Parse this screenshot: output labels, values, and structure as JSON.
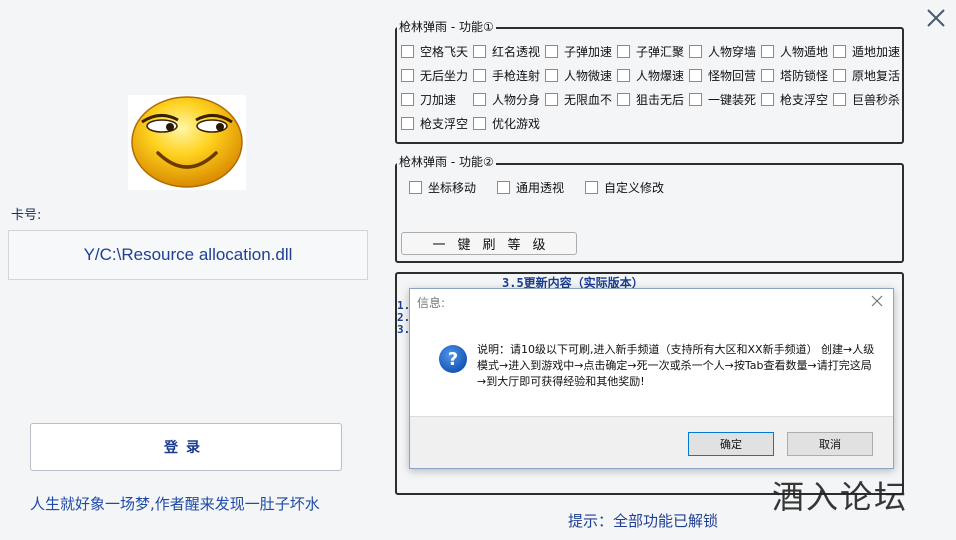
{
  "card": {
    "label": "卡号:",
    "value": "Y/C:\\Resource allocation.dll"
  },
  "login_label": "登录",
  "motto": "人生就好象一场梦,作者醒来发现一肚子坏水",
  "group1": {
    "title": "枪林弹雨 - 功能①",
    "items": [
      {
        "label": "空格飞天",
        "checked": false
      },
      {
        "label": "红名透视",
        "checked": false
      },
      {
        "label": "子弹加速",
        "checked": false
      },
      {
        "label": "子弹汇聚",
        "checked": false
      },
      {
        "label": "人物穿墙",
        "checked": false
      },
      {
        "label": "人物遁地",
        "checked": false
      },
      {
        "label": "遁地加速",
        "checked": false
      },
      {
        "label": "无后坐力",
        "checked": false
      },
      {
        "label": "手枪连射",
        "checked": false
      },
      {
        "label": "人物微速",
        "checked": false
      },
      {
        "label": "人物爆速",
        "checked": false
      },
      {
        "label": "怪物回营",
        "checked": false
      },
      {
        "label": "塔防锁怪",
        "checked": false
      },
      {
        "label": "原地复活",
        "checked": false
      },
      {
        "label": "刀加速",
        "checked": false
      },
      {
        "label": "人物分身",
        "checked": false
      },
      {
        "label": "无限血不",
        "checked": false
      },
      {
        "label": "狙击无后",
        "checked": false
      },
      {
        "label": "一键装死",
        "checked": false
      },
      {
        "label": "枪支浮空",
        "checked": false
      },
      {
        "label": "巨兽秒杀",
        "checked": false
      },
      {
        "label": "枪支浮空",
        "checked": false
      },
      {
        "label": "优化游戏",
        "checked": false
      }
    ]
  },
  "group2": {
    "title": "枪林弹雨 - 功能②",
    "items": [
      {
        "label": "坐标移动",
        "checked": false
      },
      {
        "label": "通用透视",
        "checked": false
      },
      {
        "label": "自定义修改",
        "checked": false
      }
    ],
    "level_button": "一键刷等级"
  },
  "update": {
    "title": "3.5更新内容（实际版本）",
    "lines": [
      "1.",
      "2.",
      "3."
    ]
  },
  "dialog": {
    "title": "信息:",
    "message": "说明：请10级以下可刷,进入新手频道（支持所有大区和XX新手频道） 创建→人级模式→进入到游戏中→点击确定→死一次或杀一个人→按Tab查看数量→请打完这局→到大厅即可获得经验和其他奖励!",
    "ok": "确定",
    "cancel": "取消",
    "icon": "question-icon"
  },
  "tip": "提示：全部功能已解锁",
  "watermark": "酒入论坛",
  "colors": {
    "accent_text": "#1f3f93",
    "border": "#2d2d2d",
    "background": "#f4f5f7",
    "smiley_yellow": "#f5b800",
    "question_blue": "#1c63c9"
  }
}
